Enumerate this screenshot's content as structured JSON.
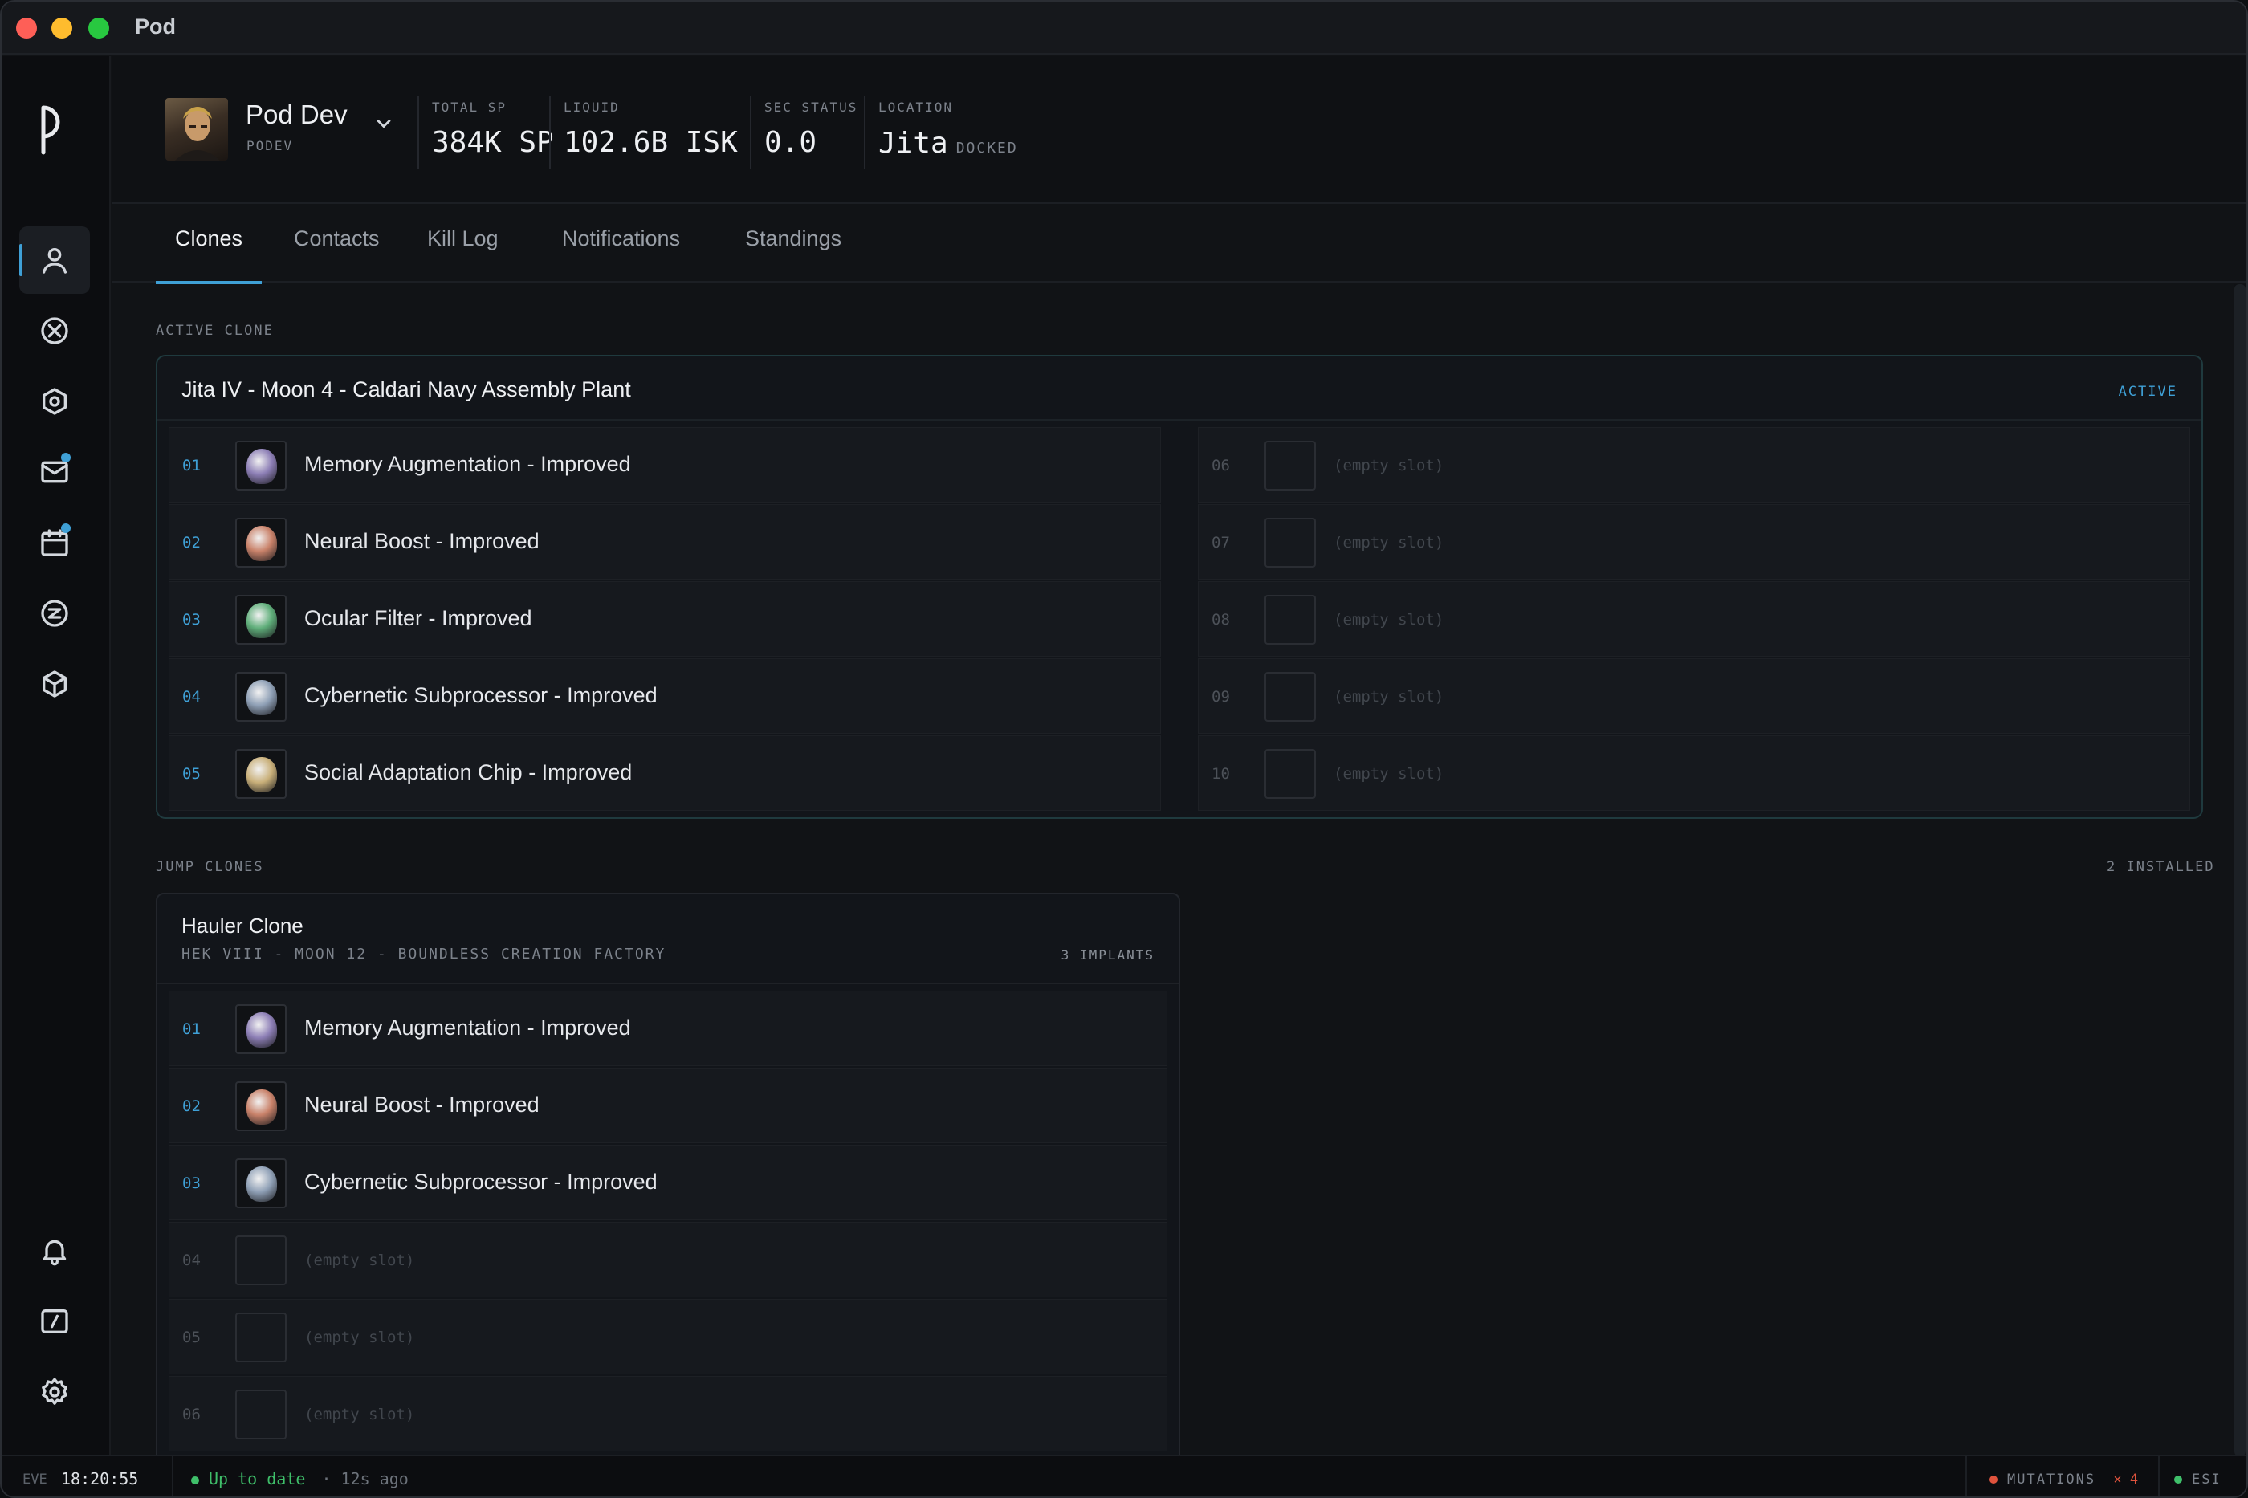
{
  "window": {
    "title": "Pod"
  },
  "character": {
    "name": "Pod Dev",
    "ticker": "PODEV"
  },
  "stats": [
    {
      "label": "TOTAL SP",
      "value": "384K SP"
    },
    {
      "label": "LIQUID",
      "value": "102.6B ISK"
    },
    {
      "label": "SEC STATUS",
      "value": "0.0"
    },
    {
      "label": "LOCATION",
      "value": "Jita",
      "sub": "DOCKED"
    }
  ],
  "tabs": [
    "Clones",
    "Contacts",
    "Kill Log",
    "Notifications",
    "Standings"
  ],
  "active_tab": "Clones",
  "active_clone": {
    "section_label": "ACTIVE CLONE",
    "location": "Jita IV - Moon 4 - Caldari Navy Assembly Plant",
    "badge": "ACTIVE",
    "slots": [
      {
        "num": "01",
        "name": "Memory Augmentation - Improved",
        "color": "#8d7fb6"
      },
      {
        "num": "02",
        "name": "Neural Boost - Improved",
        "color": "#c9826a"
      },
      {
        "num": "03",
        "name": "Ocular Filter - Improved",
        "color": "#5fae7a"
      },
      {
        "num": "04",
        "name": "Cybernetic Subprocessor - Improved",
        "color": "#8fa0b6"
      },
      {
        "num": "05",
        "name": "Social Adaptation Chip - Improved",
        "color": "#c9b07a"
      },
      {
        "num": "06",
        "name": "(empty slot)"
      },
      {
        "num": "07",
        "name": "(empty slot)"
      },
      {
        "num": "08",
        "name": "(empty slot)"
      },
      {
        "num": "09",
        "name": "(empty slot)"
      },
      {
        "num": "10",
        "name": "(empty slot)"
      }
    ]
  },
  "jump_clones": {
    "section_label": "JUMP CLONES",
    "count_label": "2 INSTALLED",
    "clones": [
      {
        "name": "Hauler Clone",
        "location": "HEK VIII - MOON 12 - BOUNDLESS CREATION FACTORY",
        "implant_count": "3 IMPLANTS",
        "slots": [
          {
            "num": "01",
            "name": "Memory Augmentation - Improved",
            "color": "#8d7fb6"
          },
          {
            "num": "02",
            "name": "Neural Boost - Improved",
            "color": "#c9826a"
          },
          {
            "num": "03",
            "name": "Cybernetic Subprocessor - Improved",
            "color": "#8fa0b6"
          },
          {
            "num": "04",
            "name": "(empty slot)"
          },
          {
            "num": "05",
            "name": "(empty slot)"
          },
          {
            "num": "06",
            "name": "(empty slot)"
          }
        ]
      }
    ]
  },
  "statusbar": {
    "eve_label": "EVE",
    "eve_time": "18:20:55",
    "sync_status": "Up to date",
    "sync_age": "· 12s ago",
    "mutations_label": "MUTATIONS",
    "mutations_count": "× 4",
    "esi_label": "ESI"
  },
  "colors": {
    "accent": "#3fa0d6",
    "ok": "#3fbf6a",
    "warn": "#e0533d"
  },
  "sidebar_icons": [
    "user-icon",
    "crosshair-icon",
    "hexagon-icon",
    "mail-icon",
    "calendar-icon",
    "market-icon",
    "cube-icon",
    "bell-icon",
    "terminal-icon",
    "gear-icon"
  ]
}
